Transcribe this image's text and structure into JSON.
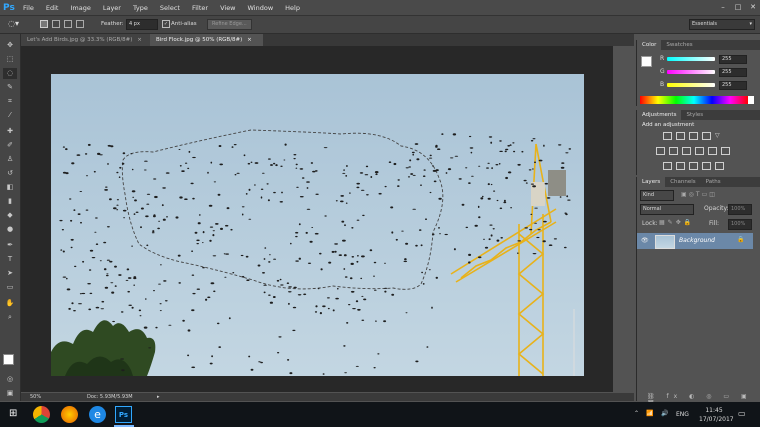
{
  "app": {
    "logo": "Ps"
  },
  "menu": [
    "File",
    "Edit",
    "Image",
    "Layer",
    "Type",
    "Select",
    "Filter",
    "View",
    "Window",
    "Help"
  ],
  "options": {
    "feather_label": "Feather:",
    "feather_value": "4 px",
    "antialias_label": "Anti-alias",
    "refine_label": "Refine Edge...",
    "workspace": "Essentials"
  },
  "tabs": [
    {
      "label": "Let's Add Birds.jpg @ 33.3% (RGB/8#)",
      "close": "×"
    },
    {
      "label": "Bird Flock.jpg @ 50% (RGB/8#)",
      "close": "×"
    }
  ],
  "status": {
    "zoom": "50%",
    "doc": "Doc: 5.93M/5.93M"
  },
  "color_panel": {
    "tabs": [
      "Color",
      "Swatches"
    ],
    "channels": [
      {
        "label": "R",
        "value": "255"
      },
      {
        "label": "G",
        "value": "255"
      },
      {
        "label": "B",
        "value": "255"
      }
    ]
  },
  "adjustments_panel": {
    "tabs": [
      "Adjustments",
      "Styles"
    ],
    "heading": "Add an adjustment"
  },
  "layers_panel": {
    "tabs": [
      "Layers",
      "Channels",
      "Paths"
    ],
    "kind_label": "Kind",
    "blend_mode": "Normal",
    "opacity_label": "Opacity:",
    "opacity_value": "100%",
    "lock_label": "Lock:",
    "fill_label": "Fill:",
    "fill_value": "100%",
    "layer_name": "Background"
  },
  "taskbar": {
    "language": "ENG",
    "time": "11:45",
    "date": "17/07/2017"
  },
  "colors": {
    "accent": "#31a8ff",
    "crane": "#e8b21a",
    "sky": "#b4cbdb"
  }
}
